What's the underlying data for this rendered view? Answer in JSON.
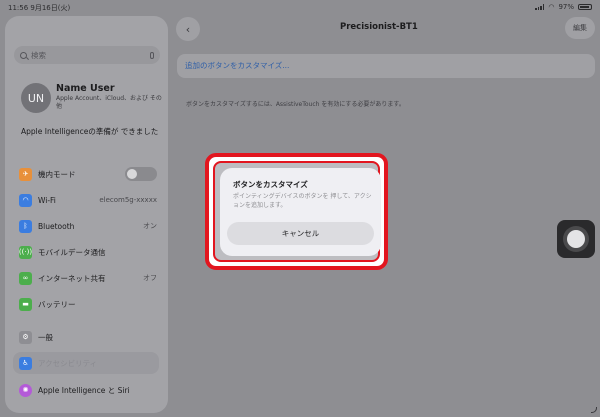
{
  "status": {
    "time_date": "11:56  9月16日(火)",
    "battery": "97%"
  },
  "sidebar": {
    "search_placeholder": "検索",
    "profile": {
      "initials": "UN",
      "name": "Name User",
      "subtitle": "Apple Account、iCloud、および その他"
    },
    "ai_ready": "Apple Intelligenceの準備が できました",
    "items": [
      {
        "label": "機内モード",
        "icon": "airplane-icon",
        "color": "#e8903a",
        "kind": "toggle",
        "value": ""
      },
      {
        "label": "Wi-Fi",
        "icon": "wifi-icon",
        "color": "#3b7de0",
        "kind": "value",
        "value": "elecom5g-xxxxx"
      },
      {
        "label": "Bluetooth",
        "icon": "bluetooth-icon",
        "color": "#3b7de0",
        "kind": "value",
        "value": "オン"
      },
      {
        "label": "モバイルデータ通信",
        "icon": "cellular-icon",
        "color": "#4cae4c",
        "kind": "chevron",
        "value": ""
      },
      {
        "label": "インターネット共有",
        "icon": "hotspot-icon",
        "color": "#4cae4c",
        "kind": "value",
        "value": "オフ"
      },
      {
        "label": "バッテリー",
        "icon": "battery-icon",
        "color": "#4cae4c",
        "kind": "chevron",
        "value": ""
      },
      {
        "label": "一般",
        "icon": "gear-icon",
        "color": "#8e8e93",
        "kind": "chevron",
        "value": ""
      },
      {
        "label": "アクセシビリティ",
        "icon": "accessibility-icon",
        "color": "#3b7de0",
        "kind": "selected",
        "value": ""
      },
      {
        "label": "Apple Intelligence と Siri",
        "icon": "siri-icon",
        "color": "#b45ad8",
        "kind": "chevron",
        "value": ""
      }
    ]
  },
  "main": {
    "back_icon": "chevron-left-icon",
    "title": "Precisionist-BT1",
    "edit_label": "編集",
    "customize_link": "追加のボタンをカスタマイズ...",
    "hint": "ボタンをカスタマイズするには、AssistiveTouch を有効にする必要があります。"
  },
  "dialog": {
    "title": "ボタンをカスタマイズ",
    "message": "ポインティングデバイスのボタンを 押して、アクションを追加します。",
    "cancel": "キャンセル"
  },
  "highlight_color": "#e2161f"
}
